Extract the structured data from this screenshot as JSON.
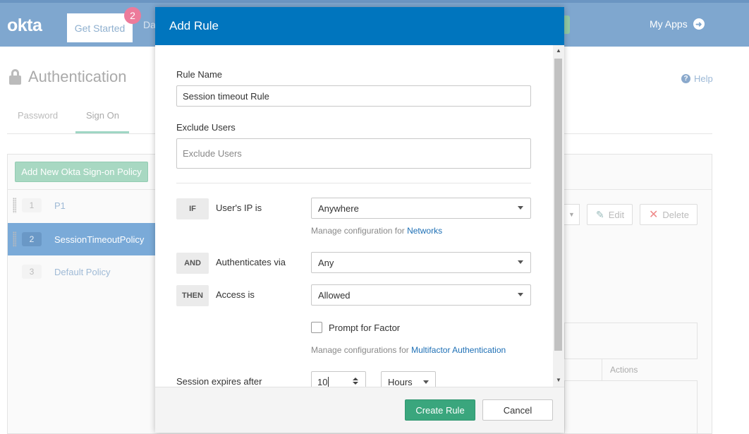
{
  "topbar": {
    "logo": "okta",
    "get_started_label": "Get Started",
    "get_started_badge": "2",
    "truncated_nav": "Da",
    "my_apps_label": "My Apps"
  },
  "page": {
    "title": "Authentication",
    "help_label": "Help",
    "tabs": [
      {
        "label": "Password"
      },
      {
        "label": "Sign On",
        "active": true
      }
    ],
    "add_policy_label": "Add New Okta Sign-on Policy",
    "policies": [
      {
        "number": "1",
        "name": "P1"
      },
      {
        "number": "2",
        "name": "SessionTimeoutPolicy",
        "selected": true
      },
      {
        "number": "3",
        "name": "Default Policy"
      }
    ],
    "edit_label": "Edit",
    "delete_label": "Delete",
    "rules_actions_header": "Actions"
  },
  "modal": {
    "title": "Add Rule",
    "rule_name_label": "Rule Name",
    "rule_name_value": "Session timeout Rule",
    "exclude_users_label": "Exclude Users",
    "exclude_users_placeholder": "Exclude Users",
    "conditions": {
      "if_tag": "IF",
      "ip_label": "User's IP is",
      "ip_value": "Anywhere",
      "networks_hint": "Manage configuration for ",
      "networks_link": "Networks",
      "and_tag": "AND",
      "auth_label": "Authenticates via",
      "auth_value": "Any",
      "then_tag": "THEN",
      "access_label": "Access is",
      "access_value": "Allowed",
      "prompt_factor_label": "Prompt for Factor",
      "prompt_factor_checked": false,
      "mfa_hint": "Manage configurations for ",
      "mfa_link": "Multifactor Authentication"
    },
    "session": {
      "label": "Session expires after",
      "value": "10",
      "unit": "Hours"
    },
    "create_button": "Create Rule",
    "cancel_button": "Cancel"
  },
  "colors": {
    "modal_header": "#0075be",
    "primary_button": "#3aa67d",
    "link": "#1d6fb5",
    "selected_policy": "#7aaad8"
  }
}
